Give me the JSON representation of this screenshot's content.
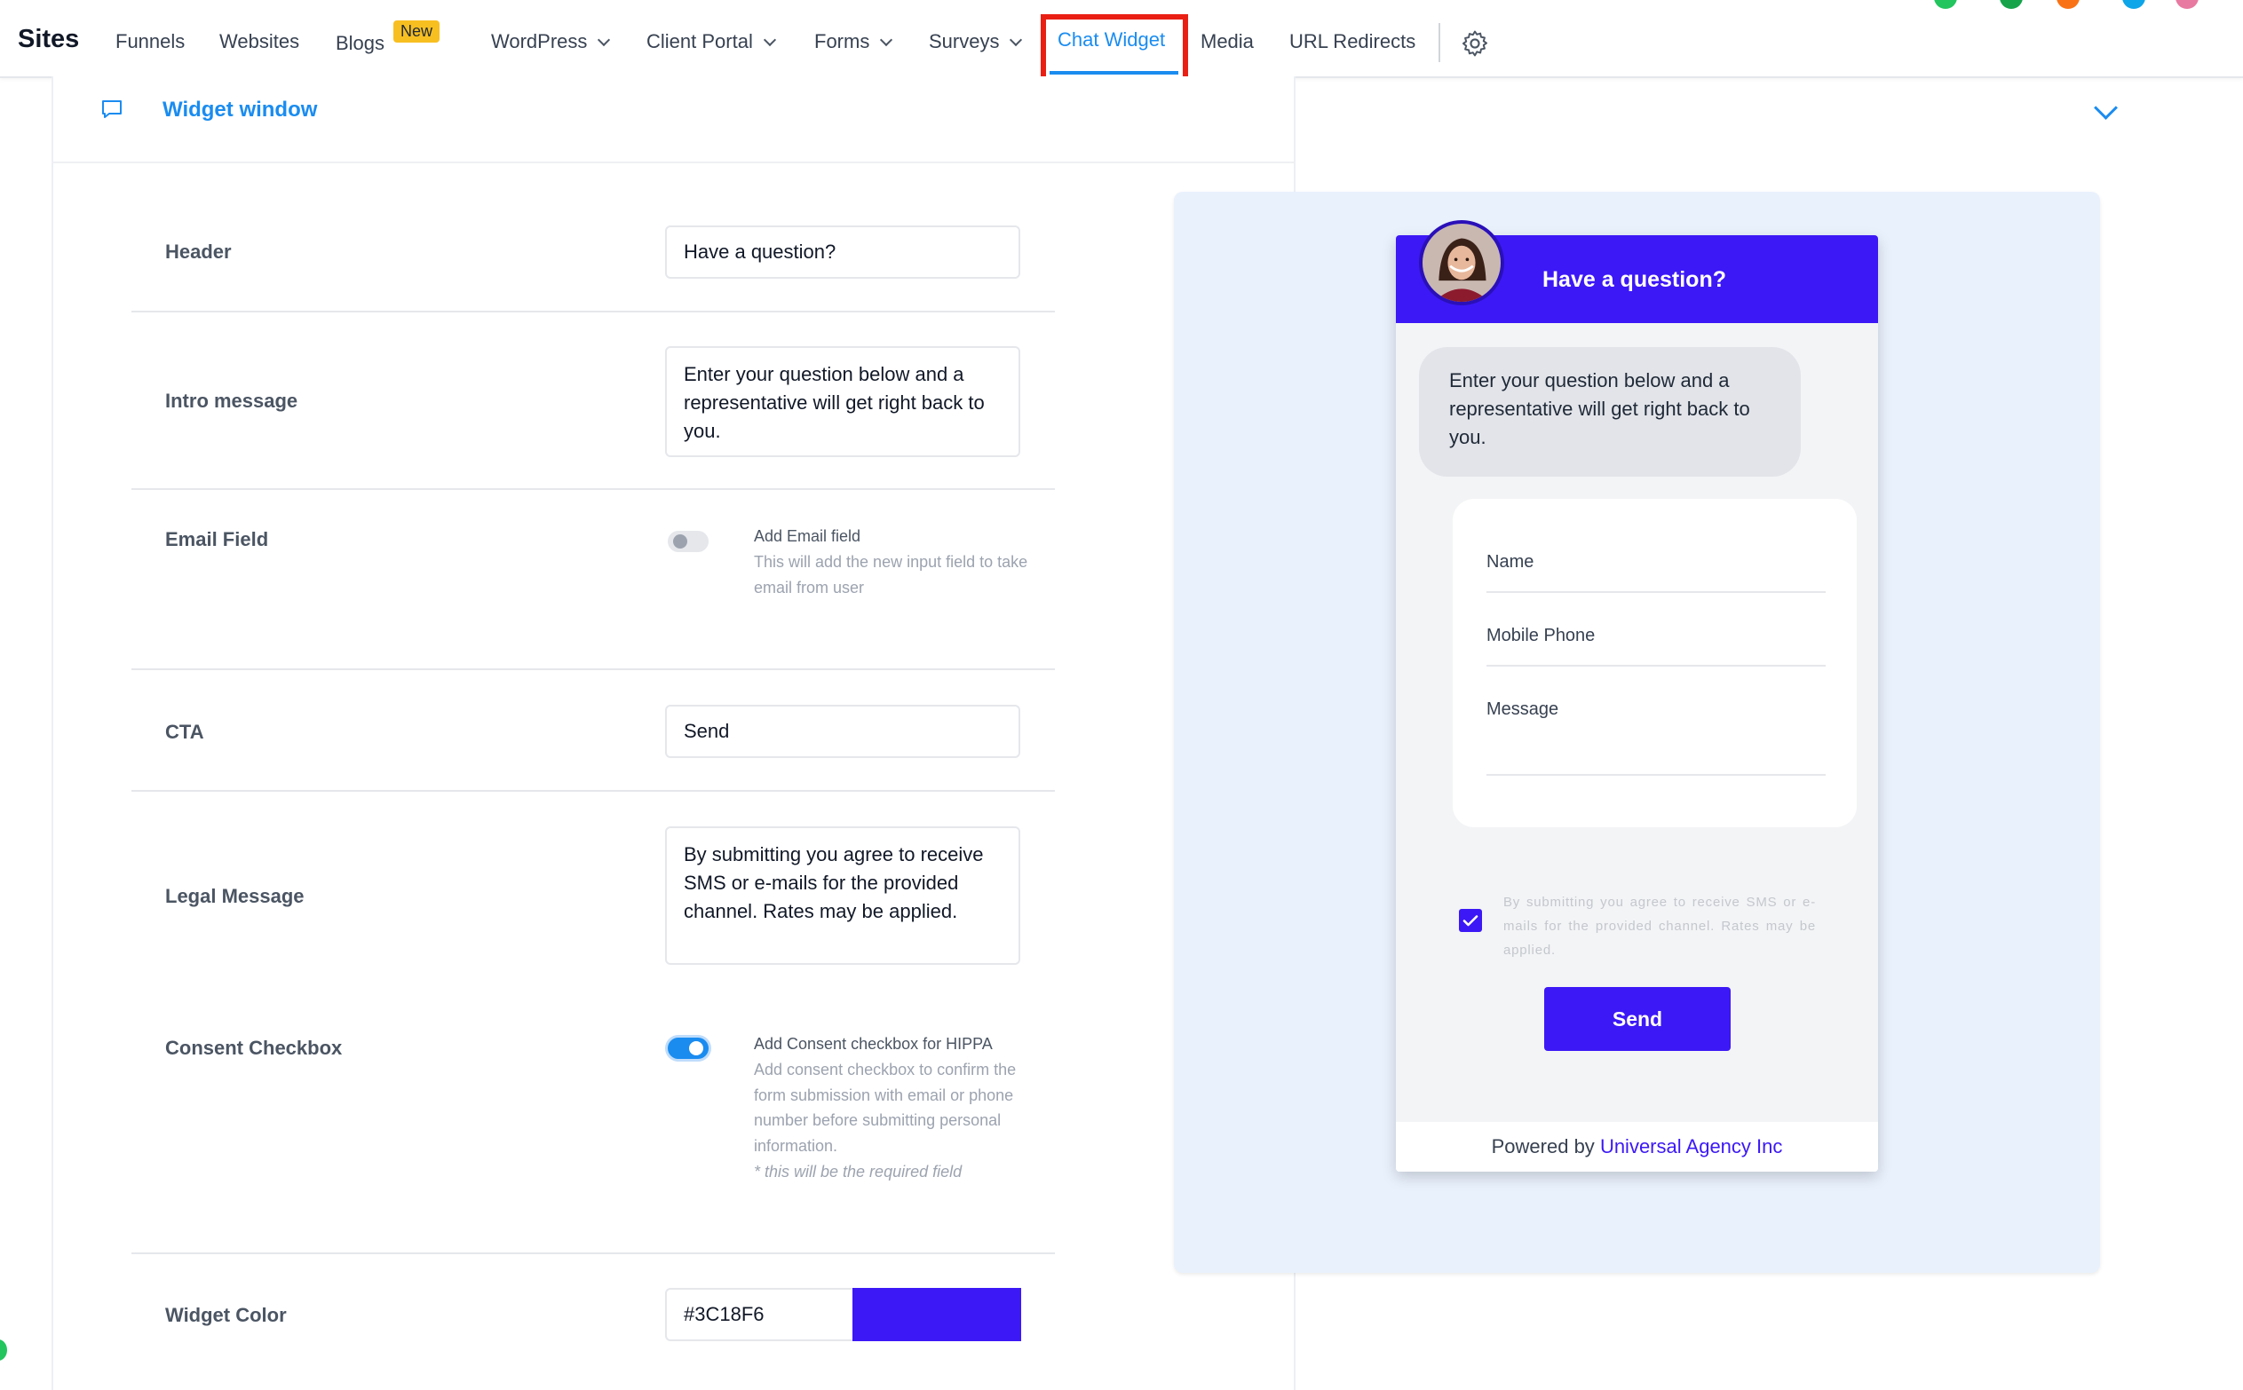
{
  "nav": {
    "title": "Sites",
    "items": [
      "Funnels",
      "Websites",
      "Blogs",
      "WordPress",
      "Client Portal",
      "Forms",
      "Surveys",
      "Chat Widget",
      "Media",
      "URL Redirects"
    ],
    "new_badge": "New",
    "active": "Chat Widget",
    "settings_icon": "gear-icon"
  },
  "section": {
    "title": "Widget window",
    "icon": "chat-bubble-icon",
    "collapse_icon": "chevron-down-icon"
  },
  "settings": {
    "header_label": "Header",
    "header_value": "Have a question?",
    "intro_label": "Intro message",
    "intro_value": "Enter your question below and a representative will get right back to you.",
    "email_label": "Email Field",
    "email_toggle_title": "Add Email field",
    "email_toggle_desc": "This will add the new input field to take email from user",
    "email_toggle_on": false,
    "cta_label": "CTA",
    "cta_value": "Send",
    "legal_label": "Legal Message",
    "legal_value": "By submitting you agree to receive SMS or e-mails for the provided channel. Rates may be applied.",
    "consent_label": "Consent Checkbox",
    "consent_toggle_title": "Add Consent checkbox for HIPPA",
    "consent_toggle_desc": "Add consent checkbox to confirm the form submission with email or phone number before submitting personal information.",
    "consent_toggle_note": "* this will be the required field",
    "consent_toggle_on": true,
    "color_label": "Widget Color",
    "color_value": "#3C18F6"
  },
  "preview": {
    "header_title": "Have a question?",
    "intro": "Enter your question below and a representative will get right back to you.",
    "fields": [
      "Name",
      "Mobile Phone",
      "Message"
    ],
    "legal": "By submitting you agree to receive SMS or e-mails for the provided channel. Rates may be applied.",
    "send": "Send",
    "powered_prefix": "Powered by",
    "powered_brand": "Universal Agency Inc",
    "checkbox_checked": true
  },
  "colors": {
    "accent": "#1a8cf0",
    "widget": "#3C18F6",
    "highlight": "#ea1f14"
  }
}
